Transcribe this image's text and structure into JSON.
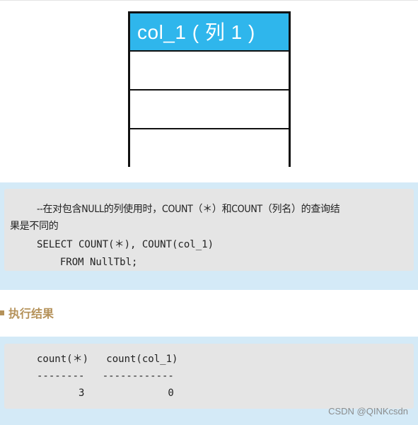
{
  "figure": {
    "header_label": "col_1 ( 列 1 )",
    "header_color": "#2fb6ec",
    "row_count": 3
  },
  "query_block": {
    "comment_line1": "--在对包含NULL的列使用时，COUNT（＊）和COUNT（列名）的查询结",
    "comment_line2": "果是不同的",
    "sql_line1": "SELECT COUNT(＊), COUNT(col_1)",
    "sql_line2": "  FROM NullTbl;"
  },
  "result_section": {
    "heading": "执行结果",
    "heading_color": "#b5925a",
    "header_line": "count(＊)   count(col_1)",
    "divider_line": "--------   ------------",
    "value_line": "       3              0",
    "columns": [
      "count(＊)",
      "count(col_1)"
    ],
    "values": [
      3,
      0
    ]
  },
  "watermark": "CSDN @QINKcsdn",
  "colors": {
    "panel_bg": "#d4eaf7",
    "code_bg": "#e5e5e5"
  }
}
